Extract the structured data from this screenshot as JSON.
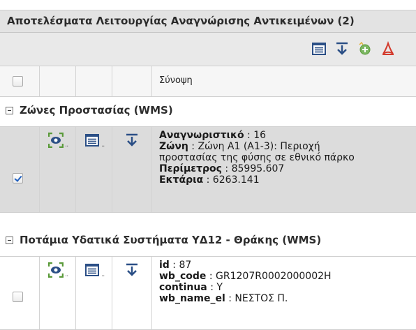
{
  "panel": {
    "top_cut_text": "· ·  ·  · ·  ·  · · ·  · ·  ·  · · ·   ·  · · · · ·  ·",
    "title": "Αποτελέσματα Λειτουργίας Αναγνώρισης Αντικειμένων (2)"
  },
  "toolbar": {
    "icons": [
      "table-view-icon",
      "download-icon",
      "add-to-map-icon",
      "pdf-export-icon"
    ]
  },
  "header": {
    "summary_label": "Σύνοψη"
  },
  "groups": [
    {
      "title": "Ζώνες Προστασίας (WMS)",
      "rows": [
        {
          "selected": true,
          "checked": true,
          "lines": [
            {
              "key": "Αναγνωριστικό",
              "sep": " : ",
              "value": "16"
            },
            {
              "key": "Ζώνη",
              "sep": " : ",
              "value": "Ζώνη Α1 (Α1-3): Περιοχή"
            },
            {
              "key": "",
              "sep": "",
              "value": "προστασίας της φύσης σε εθνικό πάρκο"
            },
            {
              "key": "Περίμετρος",
              "sep": " : ",
              "value": "85995.607"
            },
            {
              "key": "Εκτάρια",
              "sep": " : ",
              "value": "6263.141"
            }
          ]
        }
      ]
    },
    {
      "title": "Ποτάμια Υδατικά Συστήματα ΥΔ12 - Θράκης (WMS)",
      "rows": [
        {
          "selected": false,
          "checked": false,
          "lines": [
            {
              "key": "id",
              "sep": " : ",
              "value": "87"
            },
            {
              "key": "wb_code",
              "sep": " : ",
              "value": "GR1207R0002000002H"
            },
            {
              "key": "continua",
              "sep": " : ",
              "value": "Y"
            },
            {
              "key": "wb_name_el",
              "sep": " : ",
              "value": "ΝΕΣΤΟΣ Π."
            }
          ]
        }
      ]
    }
  ],
  "colors": {
    "accent_green": "#5a9a3a",
    "icon_blue": "#2b4f86",
    "pdf_red": "#d33a2c",
    "selected_row": "#dcdcdc"
  }
}
